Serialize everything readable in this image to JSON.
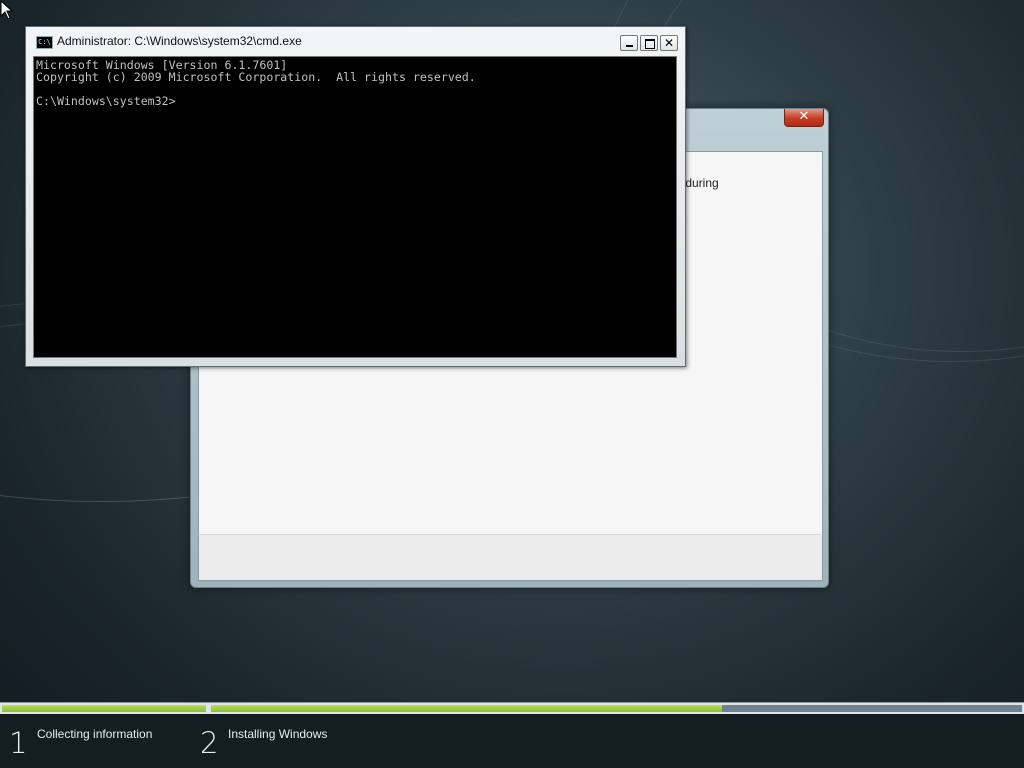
{
  "setup_window": {
    "close_glyph": "✕",
    "partial_text": "s during"
  },
  "cmd_window": {
    "title": "Administrator: C:\\Windows\\system32\\cmd.exe",
    "icon_glyph": "C:\\",
    "minimize_icon": "minimize-icon",
    "maximize_icon": "maximize-icon",
    "close_glyph": "✕",
    "console_text": "Microsoft Windows [Version 6.1.7601]\nCopyright (c) 2009 Microsoft Corporation.  All rights reserved.\n\nC:\\Windows\\system32>"
  },
  "progress": {
    "steps": [
      {
        "number": "1",
        "label": "Collecting information",
        "progress": 1.0
      },
      {
        "number": "2",
        "label": "Installing Windows",
        "progress": 0.63
      }
    ],
    "accent_color": "#8cbf2e"
  },
  "cursor": {
    "icon": "arrow-pointer-icon"
  }
}
